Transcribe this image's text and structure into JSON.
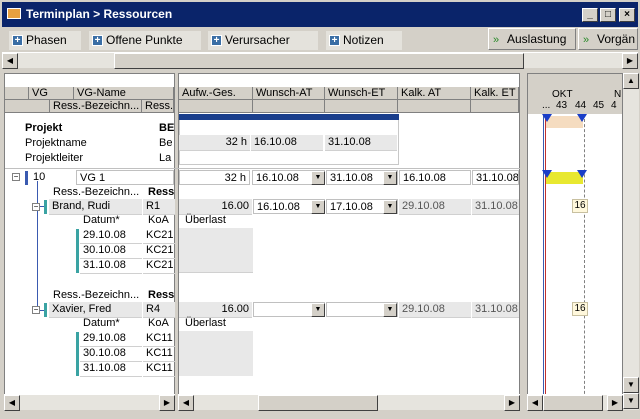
{
  "window": {
    "title": "Terminplan > Ressourcen",
    "minimize": "_",
    "maximize": "□",
    "close": "×"
  },
  "tabs": [
    {
      "label": "Phasen"
    },
    {
      "label": "Offene Punkte"
    },
    {
      "label": "Verursacher"
    },
    {
      "label": "Notizen"
    }
  ],
  "toolbar": {
    "auslastung": "Auslastung",
    "vorgaenger": "Vorgän"
  },
  "grid": {
    "left_headers": {
      "vg": "VG",
      "vg_name": "VG-Name",
      "ress_bez": "Ress.-Bezeichn...",
      "ress": "Ress..."
    },
    "right_headers": [
      "Aufw.-Ges.",
      "Wunsch-AT",
      "Wunsch-ET",
      "Kalk. AT",
      "Kalk. ET"
    ],
    "project": {
      "label": "Projekt",
      "code": "BE",
      "name_label": "Projektname",
      "name_value": "Be",
      "leader_label": "Projektleiter",
      "leader_value": "La",
      "aufw": "32 h",
      "wat": "16.10.08",
      "wet": "31.10.08"
    },
    "vg1": {
      "num": "10",
      "name": "VG 1",
      "aufw": "32 h",
      "wat": "16.10.08",
      "wet": "31.10.08",
      "kat": "16.10.08",
      "ket": "31.10.08"
    },
    "res1": {
      "ress_header": "Ress.-Bezeichn...",
      "ress_header2": "Ress",
      "name": "Brand, Rudi",
      "code": "R1",
      "aufw": "16.00",
      "wat": "16.10.08",
      "wet": "17.10.08",
      "kat": "29.10.08",
      "ket": "31.10.08",
      "datum_label": "Datum*",
      "koa_label": "KoA",
      "ueberlast": "Überlast",
      "rows": [
        {
          "date": "29.10.08",
          "koa": "KC21"
        },
        {
          "date": "30.10.08",
          "koa": "KC21"
        },
        {
          "date": "31.10.08",
          "koa": "KC21"
        }
      ]
    },
    "res2": {
      "ress_header": "Ress.-Bezeichn...",
      "ress_header2": "Ress",
      "name": "Xavier, Fred",
      "code": "R4",
      "aufw": "16.00",
      "kat": "29.10.08",
      "ket": "31.10.08",
      "datum_label": "Datum*",
      "koa_label": "KoA",
      "ueberlast": "Überlast",
      "rows": [
        {
          "date": "29.10.08",
          "koa": "KC11"
        },
        {
          "date": "30.10.08",
          "koa": "KC11"
        },
        {
          "date": "31.10.08",
          "koa": "KC11"
        }
      ]
    }
  },
  "gantt": {
    "month": "OKT",
    "month2": "N",
    "weeks": [
      "...",
      "43",
      "44",
      "45",
      "4"
    ],
    "badge1": "16",
    "badge2": "16",
    "bar_colors": {
      "project": "#f5dcc0",
      "vg": "#e8e830"
    }
  }
}
